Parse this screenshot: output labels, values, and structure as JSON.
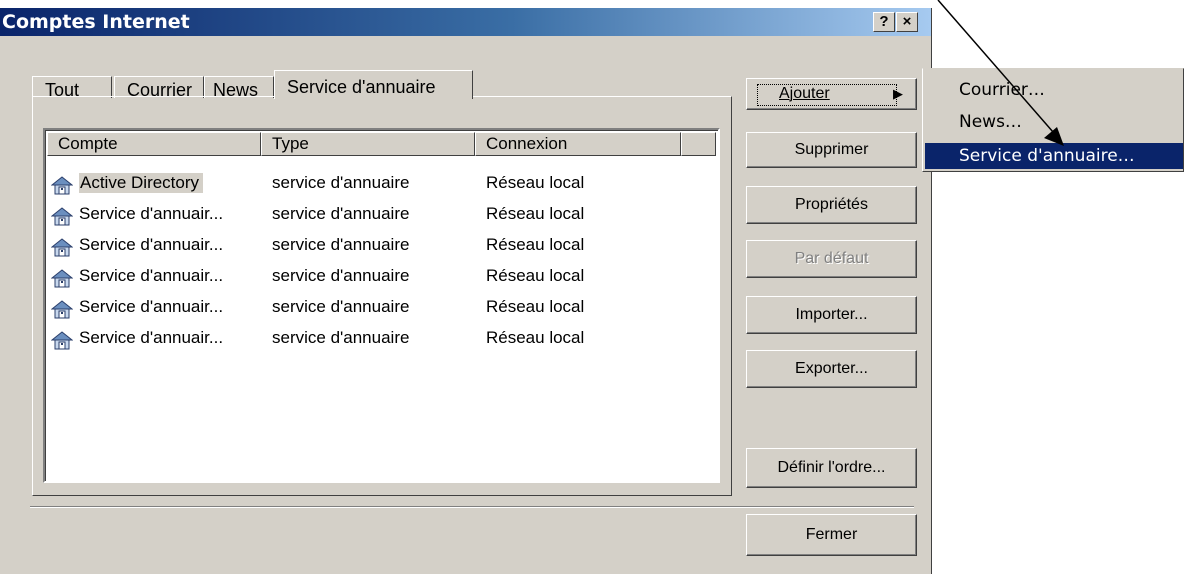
{
  "window": {
    "title": "Comptes Internet",
    "help_label": "?",
    "close_label": "×"
  },
  "tabs": [
    {
      "label": "Tout"
    },
    {
      "label": "Courrier"
    },
    {
      "label": "News"
    },
    {
      "label": "Service d'annuaire"
    }
  ],
  "list": {
    "columns": [
      "Compte",
      "Type",
      "Connexion"
    ],
    "rows": [
      {
        "compte": "Active Directory",
        "type": "service d'annuaire",
        "connexion": "Réseau local"
      },
      {
        "compte": "Service d'annuair...",
        "type": "service d'annuaire",
        "connexion": "Réseau local"
      },
      {
        "compte": "Service d'annuair...",
        "type": "service d'annuaire",
        "connexion": "Réseau local"
      },
      {
        "compte": "Service d'annuair...",
        "type": "service d'annuaire",
        "connexion": "Réseau local"
      },
      {
        "compte": "Service d'annuair...",
        "type": "service d'annuaire",
        "connexion": "Réseau local"
      },
      {
        "compte": "Service d'annuair...",
        "type": "service d'annuaire",
        "connexion": "Réseau local"
      }
    ]
  },
  "buttons": {
    "ajouter": "Ajouter",
    "supprimer": "Supprimer",
    "proprietes": "Propriétés",
    "par_defaut": "Par défaut",
    "importer": "Importer...",
    "exporter": "Exporter...",
    "definir_ordre": "Définir l'ordre...",
    "fermer": "Fermer"
  },
  "menu": {
    "items": [
      "Courrier…",
      "News…",
      "Service d'annuaire…"
    ],
    "highlighted": "Service d'annuaire…"
  },
  "colors": {
    "titlebar": "#0a246a",
    "face": "#d4d0c8",
    "highlight": "#0a246a"
  }
}
